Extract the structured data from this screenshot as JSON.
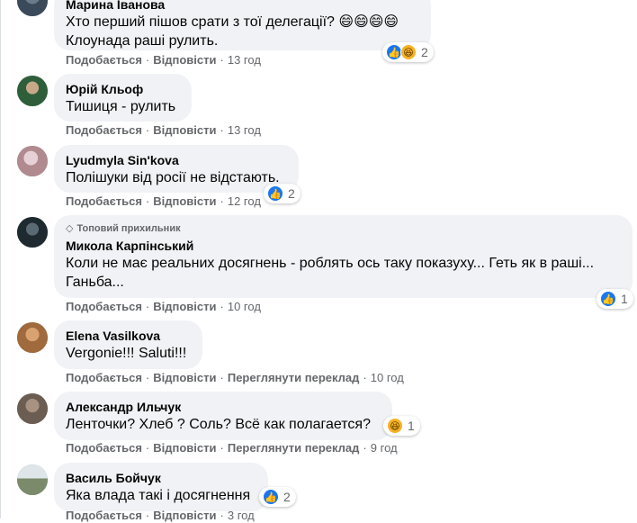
{
  "labels": {
    "like": "Подобається",
    "reply": "Відповісти",
    "translate": "Переглянути переклад",
    "sep": "·"
  },
  "comments": [
    {
      "author": "Марина Іванова",
      "lines": [
        "Хто перший пішов срати з тої делегації? 😄😄😄😄",
        "Клоунада раші рулить."
      ],
      "time": "13 год",
      "reactions": {
        "icons": [
          "like-icon",
          "haha-icon"
        ],
        "count": "2"
      },
      "avatar_color": "#3b4a5a"
    },
    {
      "author": "Юрій Кльоф",
      "lines": [
        "Тишиця - рулить"
      ],
      "time": "13 год",
      "avatar_color": "#2f5f3a"
    },
    {
      "author": "Lyudmyla Sin'kova",
      "lines": [
        "Полішуки від росії не відстають."
      ],
      "time": "12 год",
      "reactions": {
        "icons": [
          "like-icon"
        ],
        "count": "2"
      },
      "avatar_color": "#b08a8f"
    },
    {
      "badge": "Топовий прихильник",
      "author": "Микола Карпінський",
      "lines": [
        "Коли не має реальних досягнень - роблять ось таку показуху... Геть як в раші...",
        "Ганьба..."
      ],
      "time": "10 год",
      "reactions": {
        "icons": [
          "like-icon"
        ],
        "count": "1"
      },
      "avatar_color": "#1e2a30"
    },
    {
      "author": "Elena Vasilkova",
      "lines": [
        "Vergonie!!! Saluti!!!"
      ],
      "time": "10 год",
      "translate": true,
      "avatar_color": "#a06a3c"
    },
    {
      "author": "Александр Ильчук",
      "lines": [
        "Ленточки? Хлеб ? Соль? Всё как полагается?"
      ],
      "time": "9 год",
      "translate": true,
      "reactions": {
        "icons": [
          "haha-icon"
        ],
        "count": "1"
      },
      "avatar_color": "#6b5d52"
    },
    {
      "author": "Василь Бойчук",
      "lines": [
        "Яка влада такі і досягнення"
      ],
      "time": "3 год",
      "reactions": {
        "icons": [
          "like-icon"
        ],
        "count": "2"
      },
      "avatar_color": "#7a8a6a"
    }
  ]
}
